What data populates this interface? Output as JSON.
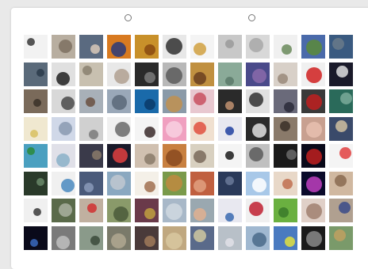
{
  "selectors": [
    {
      "name": "selector-left",
      "selected": false
    },
    {
      "name": "selector-right",
      "selected": false
    }
  ],
  "thumbnails": [
    {
      "bg": "#f2f2f2",
      "fg": "#3a3a3a"
    },
    {
      "bg": "#b8aea0",
      "fg": "#7c7060"
    },
    {
      "bg": "#5a6a80",
      "fg": "#d8c8b8"
    },
    {
      "bg": "#d87a20",
      "fg": "#2a3a7a"
    },
    {
      "bg": "#c8902a",
      "fg": "#8a4a10"
    },
    {
      "bg": "#e8e8e8",
      "fg": "#303030"
    },
    {
      "bg": "#f4f4f4",
      "fg": "#d0a040"
    },
    {
      "bg": "#c8c8c8",
      "fg": "#9a9a9a"
    },
    {
      "bg": "#d8d8d8",
      "fg": "#a8a8a8"
    },
    {
      "bg": "#f0f0f0",
      "fg": "#6a8a5a"
    },
    {
      "bg": "#4a6aaa",
      "fg": "#5a8a3a"
    },
    {
      "bg": "#3a5a80",
      "fg": "#6a7a8a"
    },
    {
      "bg": "#5a6a7a",
      "fg": "#2a3a4a"
    },
    {
      "bg": "#e0e0e0",
      "fg": "#202020"
    },
    {
      "bg": "#c8c0b0",
      "fg": "#8a8070"
    },
    {
      "bg": "#e8e8e8",
      "fg": "#b0a090"
    },
    {
      "bg": "#2a2a2a",
      "fg": "#7a7a7a"
    },
    {
      "bg": "#b8b8b8",
      "fg": "#5a5a5a"
    },
    {
      "bg": "#c09040",
      "fg": "#6a4020"
    },
    {
      "bg": "#8aaa98",
      "fg": "#5a7a6a"
    },
    {
      "bg": "#4a4a8a",
      "fg": "#8a6aaa"
    },
    {
      "bg": "#d8d0c8",
      "fg": "#9a8a7a"
    },
    {
      "bg": "#f0f0f0",
      "fg": "#d02020"
    },
    {
      "bg": "#1a1a2a",
      "fg": "#e0e0e0"
    },
    {
      "bg": "#7a6a5a",
      "fg": "#3a3028"
    },
    {
      "bg": "#d8d8d8",
      "fg": "#4a4a4a"
    },
    {
      "bg": "#a8b0b8",
      "fg": "#6a5040"
    },
    {
      "bg": "#9aa8b8",
      "fg": "#5a6878"
    },
    {
      "bg": "#1a6aaa",
      "fg": "#0a3a6a"
    },
    {
      "bg": "#8a9aa8",
      "fg": "#c09050"
    },
    {
      "bg": "#e8c8d0",
      "fg": "#c85060"
    },
    {
      "bg": "#2a2a2a",
      "fg": "#c09070"
    },
    {
      "bg": "#e0e0e0",
      "fg": "#303030"
    },
    {
      "bg": "#6a6a7a",
      "fg": "#2a2a3a"
    },
    {
      "bg": "#3a3a3a",
      "fg": "#c02020"
    },
    {
      "bg": "#2a6a5a",
      "fg": "#7aaa9a"
    },
    {
      "bg": "#f0e8d0",
      "fg": "#d8c060"
    },
    {
      "bg": "#d0d8e8",
      "fg": "#8a9ab0"
    },
    {
      "bg": "#d0d0d0",
      "fg": "#7a7a7a"
    },
    {
      "bg": "#f0f0f0",
      "fg": "#6a6a6a"
    },
    {
      "bg": "#f4f4f4",
      "fg": "#3a2a2a"
    },
    {
      "bg": "#f0a0c0",
      "fg": "#f8d0e0"
    },
    {
      "bg": "#f0e0d0",
      "fg": "#e05040"
    },
    {
      "bg": "#e8e8f0",
      "fg": "#2040a0"
    },
    {
      "bg": "#2a2a2a",
      "fg": "#e0e0e0"
    },
    {
      "bg": "#8a7a6a",
      "fg": "#3a3028"
    },
    {
      "bg": "#c8a090",
      "fg": "#e8c0b0"
    },
    {
      "bg": "#3a4a6a",
      "fg": "#d0c0a0"
    },
    {
      "bg": "#4aa0c0",
      "fg": "#2a8a3a"
    },
    {
      "bg": "#e0e0e8",
      "fg": "#8ab0c8"
    },
    {
      "bg": "#3a3a4a",
      "fg": "#8a7a6a"
    },
    {
      "bg": "#1a1a2a",
      "fg": "#e04040"
    },
    {
      "bg": "#d0c0b0",
      "fg": "#8a7a6a"
    },
    {
      "bg": "#c88040",
      "fg": "#8a4a20"
    },
    {
      "bg": "#d8d0c0",
      "fg": "#7a6a5a"
    },
    {
      "bg": "#f4f4f4",
      "fg": "#1a1a1a"
    },
    {
      "bg": "#c0c0c0",
      "fg": "#5a5a5a"
    },
    {
      "bg": "#1a1a1a",
      "fg": "#6a6a6a"
    },
    {
      "bg": "#0a0a1a",
      "fg": "#c02020"
    },
    {
      "bg": "#f4f4f4",
      "fg": "#e04040"
    },
    {
      "bg": "#2a3a2a",
      "fg": "#6a8a6a"
    },
    {
      "bg": "#f0f0f0",
      "fg": "#4a8ac0"
    },
    {
      "bg": "#4a5a7a",
      "fg": "#8a9aba"
    },
    {
      "bg": "#8aa8c0",
      "fg": "#c0c8d0"
    },
    {
      "bg": "#f4f0e8",
      "fg": "#a07050"
    },
    {
      "bg": "#7a9a4a",
      "fg": "#c08a40"
    },
    {
      "bg": "#c06040",
      "fg": "#e0a080"
    },
    {
      "bg": "#2a3a5a",
      "fg": "#6a7a9a"
    },
    {
      "bg": "#a8c8e8",
      "fg": "#ffffff"
    },
    {
      "bg": "#e8d8c8",
      "fg": "#c07050"
    },
    {
      "bg": "#0a0a2a",
      "fg": "#c040c0"
    },
    {
      "bg": "#d0b8a0",
      "fg": "#8a6a50"
    },
    {
      "bg": "#f0f0f0",
      "fg": "#3a3a3a"
    },
    {
      "bg": "#5a6a4a",
      "fg": "#aab0a0"
    },
    {
      "bg": "#c0b0a0",
      "fg": "#d03030"
    },
    {
      "bg": "#8a9a6a",
      "fg": "#4a5a3a"
    },
    {
      "bg": "#6a3a4a",
      "fg": "#c0a040"
    },
    {
      "bg": "#a8b8c8",
      "fg": "#d0d8e0"
    },
    {
      "bg": "#9aa8b0",
      "fg": "#e0b090"
    },
    {
      "bg": "#e8e8f0",
      "fg": "#3a6ab0"
    },
    {
      "bg": "#f0f0f0",
      "fg": "#c02030"
    },
    {
      "bg": "#6ab040",
      "fg": "#3a7a2a"
    },
    {
      "bg": "#e0d0c8",
      "fg": "#a08070"
    },
    {
      "bg": "#b0a090",
      "fg": "#3a4a8a"
    },
    {
      "bg": "#0a0a1a",
      "fg": "#3a6ac0"
    },
    {
      "bg": "#7a7a7a",
      "fg": "#c0c0c0"
    },
    {
      "bg": "#8a9a8a",
      "fg": "#3a4a3a"
    },
    {
      "bg": "#7a7a6a",
      "fg": "#b0a890"
    },
    {
      "bg": "#4a3a3a",
      "fg": "#a07a5a"
    },
    {
      "bg": "#c0a880",
      "fg": "#d8c8a0"
    },
    {
      "bg": "#5a6a8a",
      "fg": "#d0c8a0"
    },
    {
      "bg": "#b8c0c8",
      "fg": "#e0e0e8"
    },
    {
      "bg": "#a0b8d0",
      "fg": "#4a6a8a"
    },
    {
      "bg": "#4a7ac0",
      "fg": "#e0e040"
    },
    {
      "bg": "#1a1a1a",
      "fg": "#8a8a8a"
    },
    {
      "bg": "#7a9a6a",
      "fg": "#c0a060"
    }
  ]
}
